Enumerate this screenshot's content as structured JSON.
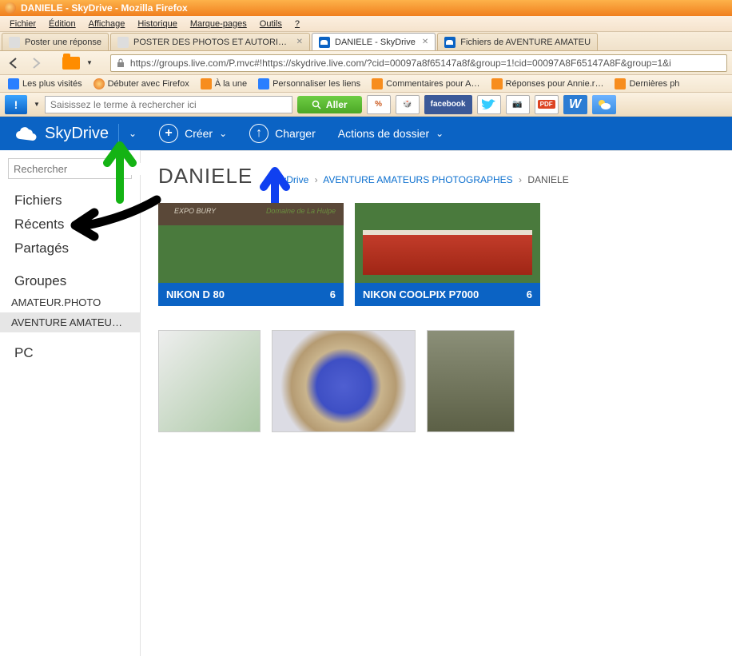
{
  "window": {
    "title": "DANIELE - SkyDrive - Mozilla Firefox"
  },
  "menubar": [
    "Fichier",
    "Édition",
    "Affichage",
    "Historique",
    "Marque-pages",
    "Outils",
    "?"
  ],
  "tabs": [
    {
      "label": "Poster une réponse",
      "active": false,
      "icon": "generic"
    },
    {
      "label": "POSTER DES PHOTOS ET AUTORISER DE…",
      "active": false,
      "icon": "generic"
    },
    {
      "label": "DANIELE - SkyDrive",
      "active": true,
      "icon": "skydrive"
    },
    {
      "label": "Fichiers de AVENTURE AMATEU",
      "active": false,
      "icon": "skydrive"
    }
  ],
  "url": "https://groups.live.com/P.mvc#!https://skydrive.live.com/?cid=00097a8f65147a8f&group=1!cid=00097A8F65147A8F&group=1&i",
  "bookmarks": [
    {
      "label": "Les plus visités",
      "icon": "blue"
    },
    {
      "label": "Débuter avec Firefox",
      "icon": "ff"
    },
    {
      "label": "À la une",
      "icon": "rss"
    },
    {
      "label": "Personnaliser les liens",
      "icon": "blue"
    },
    {
      "label": "Commentaires pour A…",
      "icon": "rss"
    },
    {
      "label": "Réponses pour Annie.r…",
      "icon": "rss"
    },
    {
      "label": "Dernières ph",
      "icon": "rss"
    }
  ],
  "toolbar": {
    "search_placeholder": "Saisissez le terme à rechercher ici",
    "go_label": "Aller"
  },
  "skydrive": {
    "brand": "SkyDrive",
    "create": "Créer",
    "upload": "Charger",
    "folder_actions": "Actions de dossier"
  },
  "sidebar": {
    "search_placeholder": "Rechercher",
    "nav": [
      "Fichiers",
      "Récents",
      "Partagés"
    ],
    "groups_label": "Groupes",
    "groups": [
      "AMATEUR.PHOTO",
      "AVENTURE AMATEUR…"
    ],
    "pc_label": "PC"
  },
  "page": {
    "title": "DANIELE",
    "breadcrumb": [
      "SkyDrive",
      "AVENTURE AMATEURS PHOTOGRAPHES",
      "DANIELE"
    ],
    "folders": [
      {
        "name": "NIKON D 80",
        "count": 6,
        "thumb": "thumb1",
        "banner_left": "EXPO BURY",
        "banner_right": "Domaine de La Hulpe"
      },
      {
        "name": "NIKON COOLPIX P7000",
        "count": 6,
        "thumb": "thumb2"
      }
    ],
    "photos": [
      {
        "thumb": "ph1"
      },
      {
        "thumb": "ph2"
      },
      {
        "thumb": "ph3"
      }
    ]
  }
}
